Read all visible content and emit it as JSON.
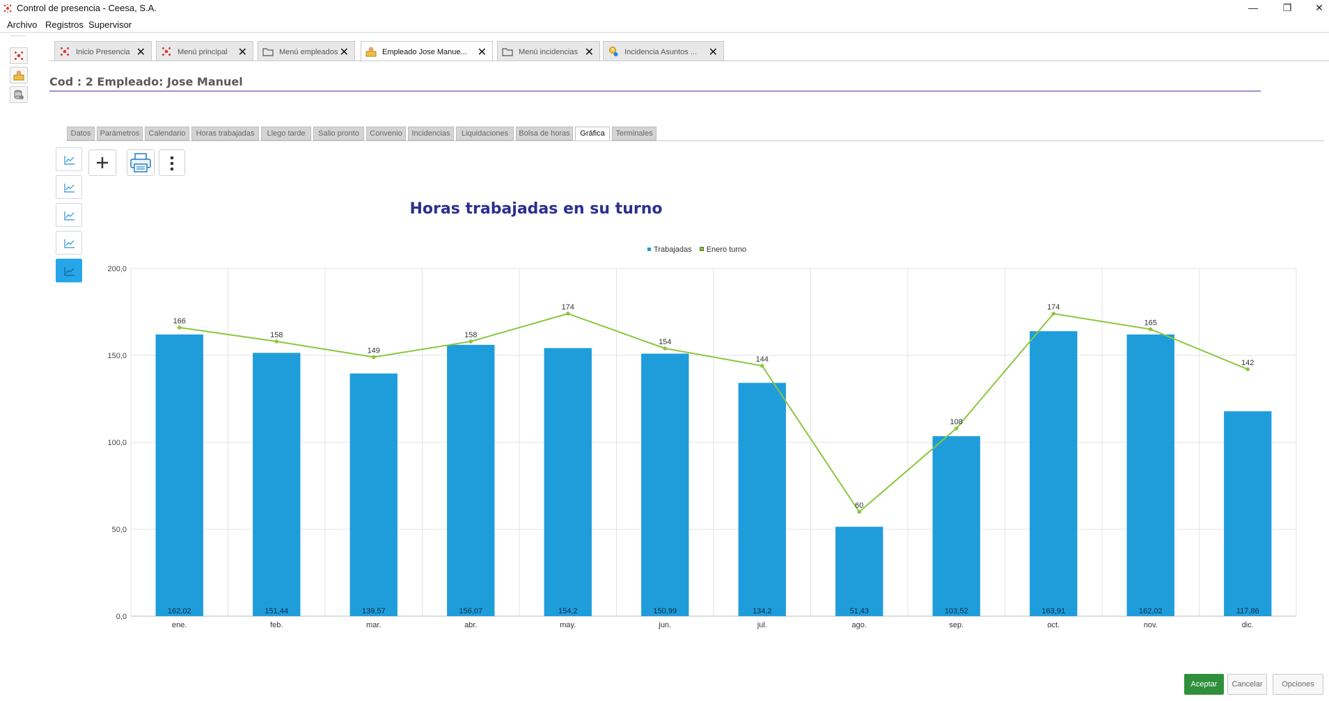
{
  "window": {
    "title": "Control de presencia - Ceesa, S.A."
  },
  "menu": [
    "Archivo",
    "Registros",
    "Supervisor"
  ],
  "doc_tabs": [
    {
      "label": "Inicio Presencia",
      "icon": "app-logo-icon"
    },
    {
      "label": "Menú principal",
      "icon": "app-logo-icon"
    },
    {
      "label": "Menú empleados",
      "icon": "folder-icon"
    },
    {
      "label": "Empleado  Jose Manue...",
      "icon": "employee-icon",
      "active": true
    },
    {
      "label": "Menú incidencias",
      "icon": "folder-icon"
    },
    {
      "label": "Incidencia  Asuntos ...",
      "icon": "incident-icon"
    }
  ],
  "employee_header": "Cod : 2 Empleado: Jose Manuel",
  "sub_tabs": [
    "Datos",
    "Parámetros",
    "Calendario",
    "Horas trabajadas",
    "Llego tarde",
    "Salio pronto",
    "Convenio",
    "Incidencias",
    "Liquidaciones",
    "Bolsa de horas",
    "Gráfica",
    "Terminales"
  ],
  "active_sub_tab": "Gráfica",
  "chart_data": {
    "type": "bar",
    "title": "Horas trabajadas en su turno",
    "categories": [
      "ene.",
      "feb.",
      "mar.",
      "abr.",
      "may.",
      "jun.",
      "jul.",
      "ago.",
      "sep.",
      "oct.",
      "nov.",
      "dic."
    ],
    "series": [
      {
        "name": "Trabajadas",
        "type": "bar",
        "color": "#1f9ddb",
        "values": [
          162.02,
          151.44,
          139.57,
          156.07,
          154.2,
          150.99,
          134.2,
          51.43,
          103.52,
          163.91,
          162.02,
          117.86
        ],
        "labels": [
          "162,02",
          "151,44",
          "139,57",
          "156,07",
          "154,2",
          "150,99",
          "134,2",
          "51,43",
          "103,52",
          "163,91",
          "162,02",
          "117,86"
        ]
      },
      {
        "name": "Enero turno",
        "type": "line",
        "color": "#8cc63f",
        "values": [
          166,
          158,
          149,
          158,
          174,
          154,
          144,
          60,
          108,
          174,
          165,
          142
        ],
        "labels": [
          "166",
          "158",
          "149",
          "158",
          "174",
          "154",
          "144",
          "60",
          "108",
          "174",
          "165",
          "142"
        ]
      }
    ],
    "ylim": [
      0,
      200
    ],
    "yticks": [
      0,
      50,
      100,
      150,
      200
    ],
    "ytick_labels": [
      "0,0",
      "50,0",
      "100,0",
      "150,0",
      "200,0"
    ],
    "grid": true,
    "legend_position": "top-center"
  },
  "footer": {
    "accept": "Aceptar",
    "cancel": "Cancelar",
    "options": "Opciones"
  }
}
